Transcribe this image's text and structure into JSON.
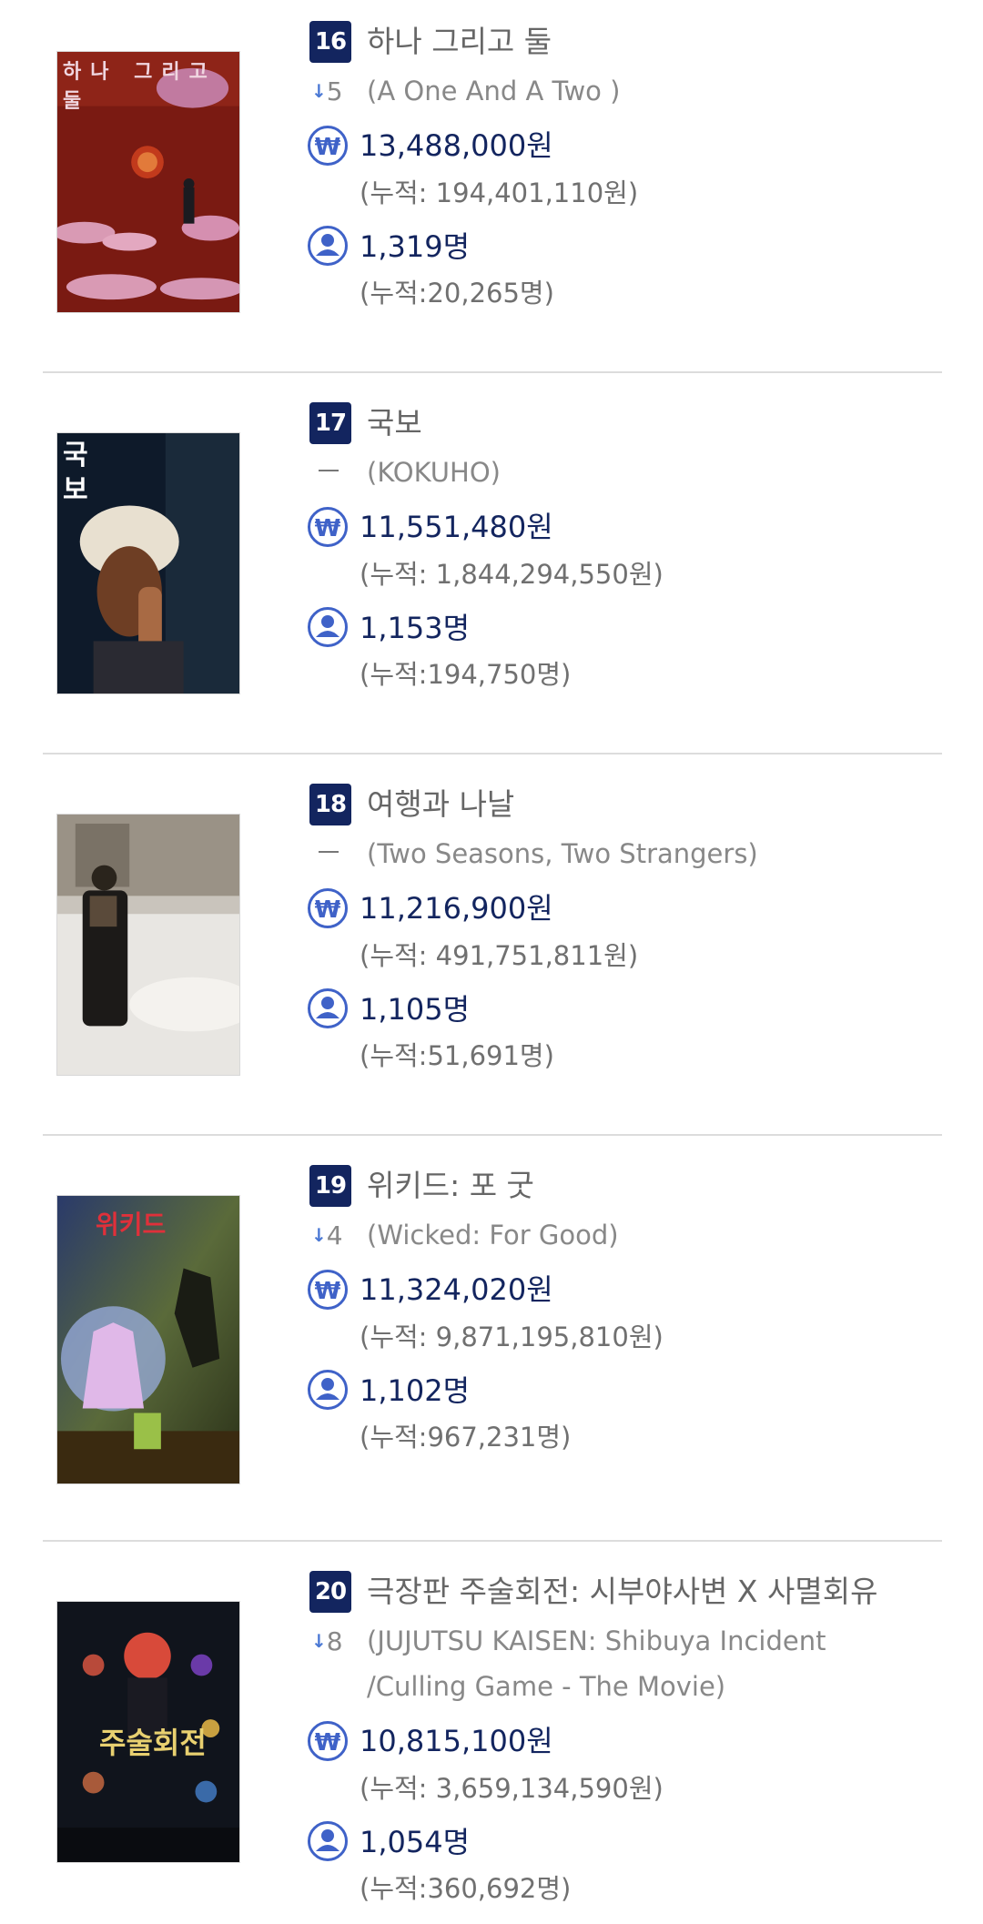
{
  "colors": {
    "rank_badge_bg": "#13255f",
    "value_text": "#13255f",
    "icon_blue": "#3f62c8",
    "arrow_blue": "#4a78d4",
    "muted_text": "#888888",
    "divider": "#dcdcdc"
  },
  "movies": [
    {
      "rank": "16",
      "title": "하나 그리고 둘",
      "change_dir": "down",
      "change": "5",
      "original_title": "(A One And A Two )",
      "revenue": "13,488,000원",
      "revenue_total": "(누적: 194,401,110원)",
      "audience": "1,319명",
      "audience_total": "(누적:20,265명)",
      "poster_icon": "poster-image",
      "poster_text": "하나 그리고 둘"
    },
    {
      "rank": "17",
      "title": "국보",
      "change_dir": "same",
      "change": "",
      "original_title": "(KOKUHO)",
      "revenue": "11,551,480원",
      "revenue_total": "(누적: 1,844,294,550원)",
      "audience": "1,153명",
      "audience_total": "(누적:194,750명)",
      "poster_icon": "poster-image",
      "poster_text": "국보"
    },
    {
      "rank": "18",
      "title": "여행과 나날",
      "change_dir": "same",
      "change": "",
      "original_title": "(Two Seasons, Two Strangers)",
      "revenue": "11,216,900원",
      "revenue_total": "(누적: 491,751,811원)",
      "audience": "1,105명",
      "audience_total": "(누적:51,691명)",
      "poster_icon": "poster-image",
      "poster_text": ""
    },
    {
      "rank": "19",
      "title": "위키드: 포 굿",
      "change_dir": "down",
      "change": "4",
      "original_title": "(Wicked: For Good)",
      "revenue": "11,324,020원",
      "revenue_total": "(누적: 9,871,195,810원)",
      "audience": "1,102명",
      "audience_total": "(누적:967,231명)",
      "poster_icon": "poster-image",
      "poster_text": "위키드"
    },
    {
      "rank": "20",
      "title": "극장판 주술회전: 시부야사변 X 사멸회유",
      "change_dir": "down",
      "change": "8",
      "original_title": "(JUJUTSU KAISEN: Shibuya Incident /Culling Game - The Movie)",
      "revenue": "10,815,100원",
      "revenue_total": "(누적: 3,659,134,590원)",
      "audience": "1,054명",
      "audience_total": "(누적:360,692명)",
      "poster_icon": "poster-image",
      "poster_text": "주술회전"
    }
  ],
  "icons": {
    "revenue": "won-icon",
    "audience": "person-icon",
    "change_down": "arrow-down-icon",
    "no_change": "dash-icon"
  }
}
